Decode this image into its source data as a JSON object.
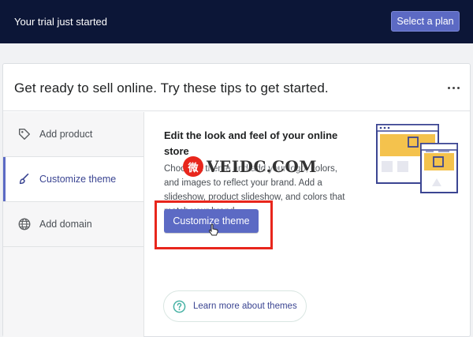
{
  "topbar": {
    "trial_text": "Your trial just started",
    "plan_button": "Select a plan"
  },
  "card": {
    "title": "Get ready to sell online. Try these tips to get started.",
    "more_icon": "more-horizontal-icon"
  },
  "sidebar": {
    "items": [
      {
        "label": "Add product",
        "icon": "tag-icon",
        "active": false
      },
      {
        "label": "Customize theme",
        "icon": "brush-icon",
        "active": true
      },
      {
        "label": "Add domain",
        "icon": "globe-icon",
        "active": false
      }
    ]
  },
  "content": {
    "heading": "Edit the look and feel of your online store",
    "description": "Choose a theme and add your logo, colors, and images to reflect your brand. Add a slideshow, product slideshow, and colors that match your brand.",
    "cta_label": "Customize theme",
    "learn_more": "Learn more about themes"
  },
  "watermark": {
    "badge": "微",
    "text": "VEIDC.COM"
  },
  "colors": {
    "topbar_bg": "#0c1637",
    "accent": "#5c6ac4",
    "highlight": "#e8261c"
  }
}
